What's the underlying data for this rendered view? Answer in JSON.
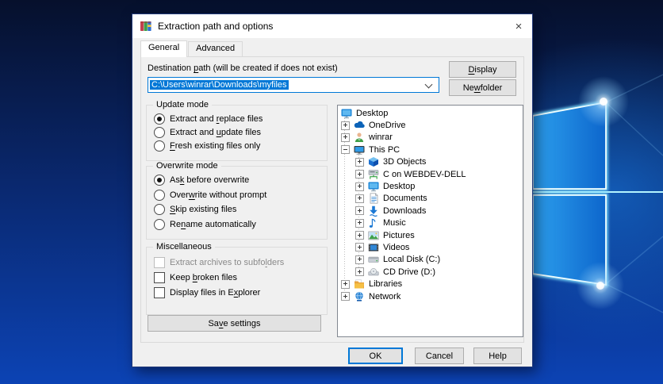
{
  "window": {
    "title": "Extraction path and options",
    "icon": "winrar-icon",
    "close_icon": "×"
  },
  "tabs": [
    {
      "label": "General",
      "active": true
    },
    {
      "label": "Advanced",
      "active": false
    }
  ],
  "destination": {
    "label": {
      "label": "Destination path (will be created if does not exist)",
      "mnemonic": 12
    },
    "path_value": "C:\\Users\\winrar\\Downloads\\myfiles"
  },
  "action_buttons": {
    "display": {
      "label": "Display",
      "mnemonic": 0
    },
    "new_folder": {
      "label": "New folder",
      "mnemonic": 2
    },
    "save_settings": {
      "label": "Save settings",
      "mnemonic": 2
    },
    "ok": {
      "label": "OK",
      "mnemonic": -1
    },
    "cancel": {
      "label": "Cancel",
      "mnemonic": -1
    },
    "help": {
      "label": "Help",
      "mnemonic": -1
    }
  },
  "groups": {
    "update_mode": {
      "title": "Update mode",
      "options": [
        {
          "label": "Extract and replace files",
          "mnemonic": 12,
          "selected": true
        },
        {
          "label": "Extract and update files",
          "mnemonic": 12,
          "selected": false
        },
        {
          "label": "Fresh existing files only",
          "mnemonic": 0,
          "selected": false
        }
      ]
    },
    "overwrite_mode": {
      "title": "Overwrite mode",
      "options": [
        {
          "label": "Ask before overwrite",
          "mnemonic": 2,
          "selected": true
        },
        {
          "label": "Overwrite without prompt",
          "mnemonic": 4,
          "selected": false
        },
        {
          "label": "Skip existing files",
          "mnemonic": 0,
          "selected": false
        },
        {
          "label": "Rename automatically",
          "mnemonic": 2,
          "selected": false
        }
      ]
    },
    "miscellaneous": {
      "title": "Miscellaneous",
      "options": [
        {
          "label": "Extract archives to subfolders",
          "mnemonic": 25,
          "checked": false,
          "disabled": true
        },
        {
          "label": "Keep broken files",
          "mnemonic": 5,
          "checked": false,
          "disabled": false
        },
        {
          "label": "Display files in Explorer",
          "mnemonic": 18,
          "checked": false,
          "disabled": false
        }
      ]
    }
  },
  "tree": {
    "items": [
      {
        "label": "Desktop",
        "level": 0,
        "expander": "none",
        "icon": "desktop-icon"
      },
      {
        "label": "OneDrive",
        "level": 1,
        "expander": "plus",
        "icon": "onedrive-icon"
      },
      {
        "label": "winrar",
        "level": 1,
        "expander": "plus",
        "icon": "user-icon"
      },
      {
        "label": "This PC",
        "level": 1,
        "expander": "minus",
        "icon": "computer-icon"
      },
      {
        "label": "3D Objects",
        "level": 2,
        "expander": "plus",
        "icon": "3d-objects-icon"
      },
      {
        "label": "C on WEBDEV-DELL",
        "level": 2,
        "expander": "plus",
        "icon": "network-drive-icon"
      },
      {
        "label": "Desktop",
        "level": 2,
        "expander": "plus",
        "icon": "desktop-icon"
      },
      {
        "label": "Documents",
        "level": 2,
        "expander": "plus",
        "icon": "documents-icon"
      },
      {
        "label": "Downloads",
        "level": 2,
        "expander": "plus",
        "icon": "downloads-icon"
      },
      {
        "label": "Music",
        "level": 2,
        "expander": "plus",
        "icon": "music-icon"
      },
      {
        "label": "Pictures",
        "level": 2,
        "expander": "plus",
        "icon": "pictures-icon"
      },
      {
        "label": "Videos",
        "level": 2,
        "expander": "plus",
        "icon": "videos-icon"
      },
      {
        "label": "Local Disk (C:)",
        "level": 2,
        "expander": "plus",
        "icon": "local-disk-icon"
      },
      {
        "label": "CD Drive (D:)",
        "level": 2,
        "expander": "plus",
        "icon": "cd-drive-icon"
      },
      {
        "label": "Libraries",
        "level": 1,
        "expander": "plus",
        "icon": "libraries-icon"
      },
      {
        "label": "Network",
        "level": 1,
        "expander": "plus",
        "icon": "network-icon"
      }
    ]
  },
  "colors": {
    "accent": "#0078d7",
    "selection_bg": "#0078d7",
    "selection_text": "#ffffff",
    "dialog_bg": "#f0f0f0",
    "titlebar_bg": "#ffffff",
    "default_button_border": "#0078d7",
    "wallpaper_dark": "#06102c",
    "wallpaper_bright": "#0c43b4",
    "logo_pane": "#1e8fe0"
  }
}
